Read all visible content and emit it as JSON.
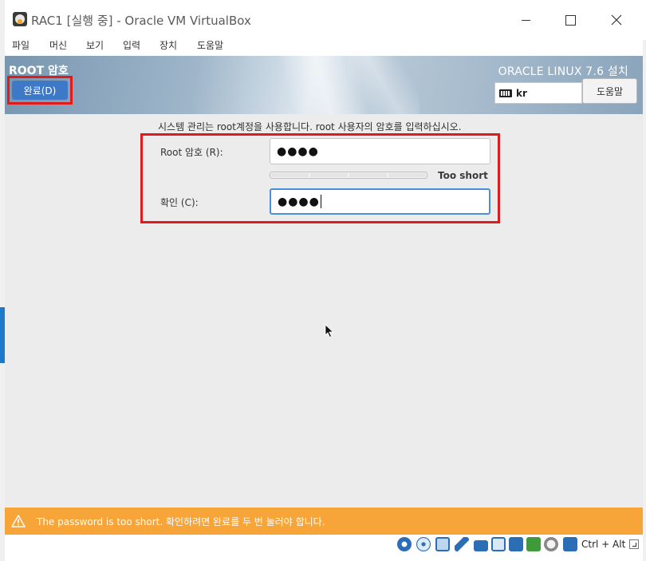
{
  "window": {
    "title": "RAC1 [실행 중] - Oracle VM VirtualBox"
  },
  "menu": {
    "items": [
      "파일",
      "머신",
      "보기",
      "입력",
      "장치",
      "도움말"
    ]
  },
  "header": {
    "page_title": "ROOT 암호",
    "done_label": "완료(D)",
    "install_title": "ORACLE LINUX 7.6 설치",
    "keyboard_layout": "kr",
    "help_label": "도움말"
  },
  "form": {
    "instruction": "시스템 관리는 root계정을 사용합니다. root 사용자의 암호를 입력하십시오.",
    "root_label": "Root 암호 (R):",
    "root_value": "●●●●",
    "strength_text": "Too short",
    "confirm_label": "확인 (C):",
    "confirm_value": "●●●●"
  },
  "warning": {
    "text": "The password is too short. 확인하려면 완료를 두 번 눌러야 합니다."
  },
  "statusbar": {
    "host_key": "Ctrl + Alt",
    "icons": [
      "hard-disk-icon",
      "optical-disk-icon",
      "network-icon",
      "usb-icon",
      "shared-folder-icon",
      "display-icon",
      "video-capture-icon",
      "cpu-icon",
      "mouse-integration-icon",
      "keyboard-arrow-icon"
    ]
  },
  "colors": {
    "highlight": "#e01b1b",
    "done_button": "#3e79c8",
    "warning_bar": "#f7a439"
  }
}
